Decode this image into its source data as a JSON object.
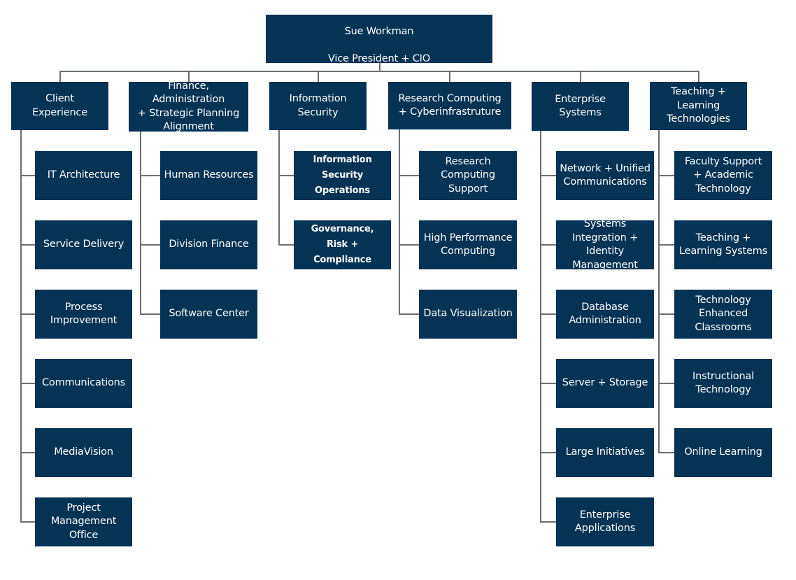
{
  "root": {
    "name": "Sue Workman",
    "title": "Vice President + CIO"
  },
  "colors": {
    "box": "#043356",
    "text": "#ffffff",
    "connector": "#6b6f74"
  },
  "divisions": [
    {
      "label": "Client\nExperience",
      "units": [
        {
          "label": "IT Architecture"
        },
        {
          "label": "Service Delivery"
        },
        {
          "label": "Process\nImprovement"
        },
        {
          "label": "Communications"
        },
        {
          "label": "MediaVision"
        },
        {
          "label": "Project\nManagement\nOffice"
        }
      ]
    },
    {
      "label": "Finance, Administration\n+ Strategic Planning\nAlignment",
      "units": [
        {
          "label": "Human Resources"
        },
        {
          "label": "Division Finance"
        },
        {
          "label": "Software Center"
        }
      ]
    },
    {
      "label": "Information\nSecurity",
      "units": [
        {
          "label": "Information\nSecurity\nOperations",
          "bold": true
        },
        {
          "label": "Governance,\nRisk + Compliance",
          "bold": true
        }
      ]
    },
    {
      "label": "Research Computing\n+ Cyberinfrastruture",
      "units": [
        {
          "label": "Research\nComputing\nSupport"
        },
        {
          "label": "High Performance\nComputing"
        },
        {
          "label": "Data Visualization"
        }
      ]
    },
    {
      "label": "Enterprise\nSystems",
      "units": [
        {
          "label": "Network + Unified\nCommunications"
        },
        {
          "label": "Systems\nIntegration +\nIdentity\nManagement"
        },
        {
          "label": "Database\nAdministration"
        },
        {
          "label": "Server + Storage"
        },
        {
          "label": "Large Initiatives"
        },
        {
          "label": "Enterprise\nApplications"
        }
      ]
    },
    {
      "label": "Teaching +\nLearning\nTechnologies",
      "units": [
        {
          "label": "Faculty Support\n+ Academic\nTechnology"
        },
        {
          "label": "Teaching +\nLearning Systems"
        },
        {
          "label": "Technology\nEnhanced\nClassrooms"
        },
        {
          "label": "Instructional\nTechnology"
        },
        {
          "label": "Online Learning"
        }
      ]
    }
  ]
}
